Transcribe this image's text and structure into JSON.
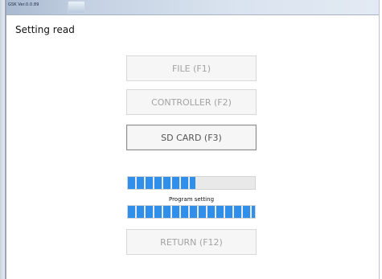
{
  "window": {
    "title": "GSK Ver.0.0.89"
  },
  "page": {
    "title": "Setting read"
  },
  "buttons": {
    "file": "FILE (F1)",
    "controller": "CONTROLLER (F2)",
    "sd_card": "SD CARD (F3)",
    "return": "RETURN (F12)"
  },
  "progress": {
    "upper_fraction": 0.53,
    "label": "Program setting",
    "lower_fraction": 1.0
  },
  "colors": {
    "progress_fill": "#2f8fea",
    "disabled_text": "#a3a3a3",
    "enabled_text": "#555555"
  }
}
